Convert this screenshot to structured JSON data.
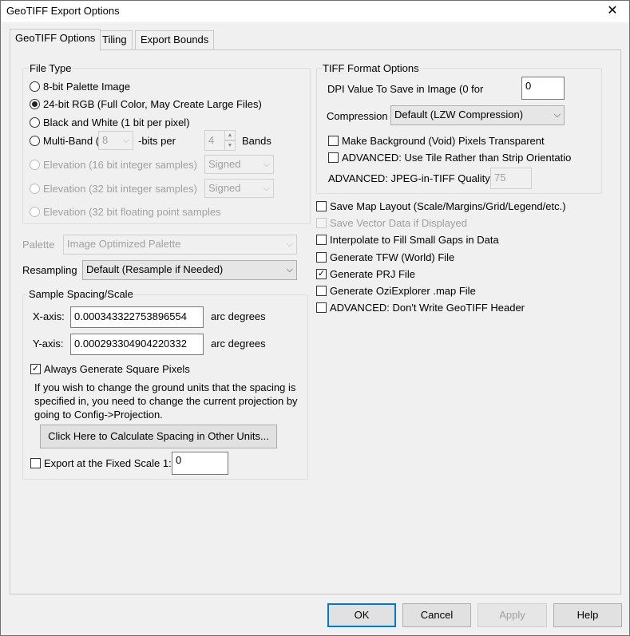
{
  "window": {
    "title": "GeoTIFF Export Options",
    "close_label": "✕"
  },
  "tabs": [
    {
      "label": "GeoTIFF Options",
      "active": true
    },
    {
      "label": "Tiling",
      "active": false
    },
    {
      "label": "Export Bounds",
      "active": false
    }
  ],
  "file_type": {
    "title": "File Type",
    "options": [
      {
        "label": "8-bit Palette Image",
        "selected": false,
        "enabled": true
      },
      {
        "label": "24-bit RGB (Full Color, May Create Large Files)",
        "selected": true,
        "enabled": true
      },
      {
        "label": "Black and White (1 bit per pixel)",
        "selected": false,
        "enabled": true
      },
      {
        "label": "Multi-Band (",
        "selected": false,
        "enabled": true
      },
      {
        "label": "Elevation (16 bit integer samples)",
        "selected": false,
        "enabled": false
      },
      {
        "label": "Elevation (32 bit integer samples)",
        "selected": false,
        "enabled": false
      },
      {
        "label": "Elevation (32 bit floating point samples",
        "selected": false,
        "enabled": false
      }
    ],
    "multiband_bits_value": "8",
    "bits_per_label": "-bits per",
    "bands_value": "4",
    "bands_label": "Bands",
    "elev16_sign": "Signed",
    "elev32_sign": "Signed"
  },
  "palette": {
    "label": "Palette",
    "value": "Image Optimized Palette"
  },
  "resampling": {
    "label": "Resampling",
    "value": "Default (Resample if Needed)"
  },
  "sample_spacing": {
    "title": "Sample Spacing/Scale",
    "x_label": "X-axis:",
    "x_value": "0.000343322753896554",
    "x_units": "arc degrees",
    "y_label": "Y-axis:",
    "y_value": "0.000293304904220332",
    "y_units": "arc degrees",
    "square_pixels_label": "Always Generate Square Pixels",
    "square_pixels_checked": true,
    "info_text": "If you wish to change the ground units that the spacing is specified in, you need to change the current projection by going to Config->Projection.",
    "calc_button": "Click Here to Calculate Spacing in Other Units...",
    "fixed_scale_label": "Export at the Fixed Scale 1:",
    "fixed_scale_checked": false,
    "fixed_scale_value": "0"
  },
  "tiff_format": {
    "title": "TIFF Format Options",
    "dpi_label": "DPI Value To Save in Image (0 for",
    "dpi_value": "0",
    "compression_label": "Compression",
    "compression_value": "Default (LZW Compression)",
    "transparent_label": "Make Background (Void) Pixels Transparent",
    "tile_label": "ADVANCED: Use Tile Rather than Strip Orientation",
    "jpeg_label": "ADVANCED: JPEG-in-TIFF Quality",
    "jpeg_value": "75"
  },
  "options": [
    {
      "label": "Save Map Layout (Scale/Margins/Grid/Legend/etc.)",
      "checked": false,
      "enabled": true
    },
    {
      "label": "Save Vector Data if Displayed",
      "checked": false,
      "enabled": false
    },
    {
      "label": "Interpolate to Fill Small Gaps in Data",
      "checked": false,
      "enabled": true
    },
    {
      "label": "Generate TFW (World) File",
      "checked": false,
      "enabled": true
    },
    {
      "label": "Generate PRJ File",
      "checked": true,
      "enabled": true
    },
    {
      "label": "Generate OziExplorer .map File",
      "checked": false,
      "enabled": true
    },
    {
      "label": "ADVANCED: Don't Write GeoTIFF Header",
      "checked": false,
      "enabled": true
    }
  ],
  "buttons": {
    "ok": "OK",
    "cancel": "Cancel",
    "apply": "Apply",
    "help": "Help"
  },
  "glyphs": {
    "check": "✓",
    "arrow": "⌵",
    "spin_up": "▲",
    "spin_down": "▼"
  }
}
